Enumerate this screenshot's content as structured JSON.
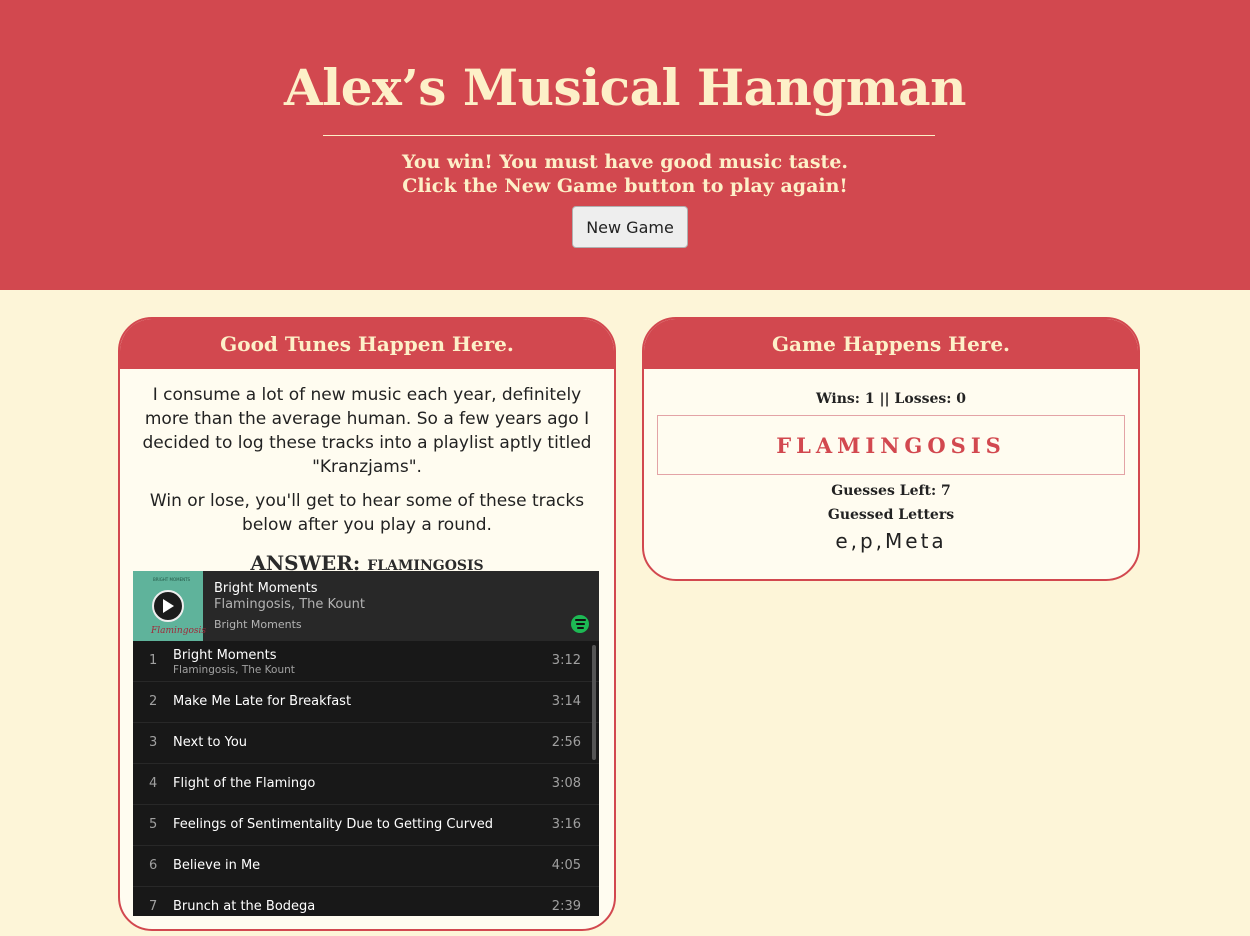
{
  "header": {
    "title": "Alex’s Musical Hangman",
    "message_line1": "You win! You must have good music taste.",
    "message_line2": "Click the New Game button to play again!",
    "new_game_label": "New Game"
  },
  "left_card": {
    "heading": "Good Tunes Happen Here.",
    "paragraph1": "I consume a lot of new music each year, definitely more than the average human. So a few years ago I decided to log these tracks into a playlist aptly titled \"Kranzjams\".",
    "paragraph2": "Win or lose, you'll get to hear some of these tracks below after you play a round.",
    "answer_label": "ANSWER:",
    "answer_value": "FLAMINGOSIS"
  },
  "player": {
    "cover_text": "Flamingosis",
    "cover_small_text": "BRIGHT MOMENTS",
    "now_playing_title": "Bright Moments",
    "now_playing_artist": "Flamingosis, The Kount",
    "now_playing_album": "Bright Moments",
    "tracks": [
      {
        "num": "1",
        "name": "Bright Moments",
        "artist": "Flamingosis, The Kount",
        "duration": "3:12"
      },
      {
        "num": "2",
        "name": "Make Me Late for Breakfast",
        "duration": "3:14"
      },
      {
        "num": "3",
        "name": "Next to You",
        "duration": "2:56"
      },
      {
        "num": "4",
        "name": "Flight of the Flamingo",
        "duration": "3:08"
      },
      {
        "num": "5",
        "name": "Feelings of Sentimentality Due to Getting Curved",
        "duration": "3:16"
      },
      {
        "num": "6",
        "name": "Believe in Me",
        "duration": "4:05"
      },
      {
        "num": "7",
        "name": "Brunch at the Bodega",
        "duration": "2:39"
      }
    ]
  },
  "right_card": {
    "heading": "Game Happens Here.",
    "scoreline": "Wins: 1 || Losses: 0",
    "word": "FLAMINGOSIS",
    "guesses_left": "Guesses Left: 7",
    "guessed_label": "Guessed Letters",
    "guessed_letters": "e,p,Meta"
  },
  "colors": {
    "accent_red": "#d2484f",
    "cream": "#fdf5d8",
    "spotify_green": "#1db954"
  }
}
